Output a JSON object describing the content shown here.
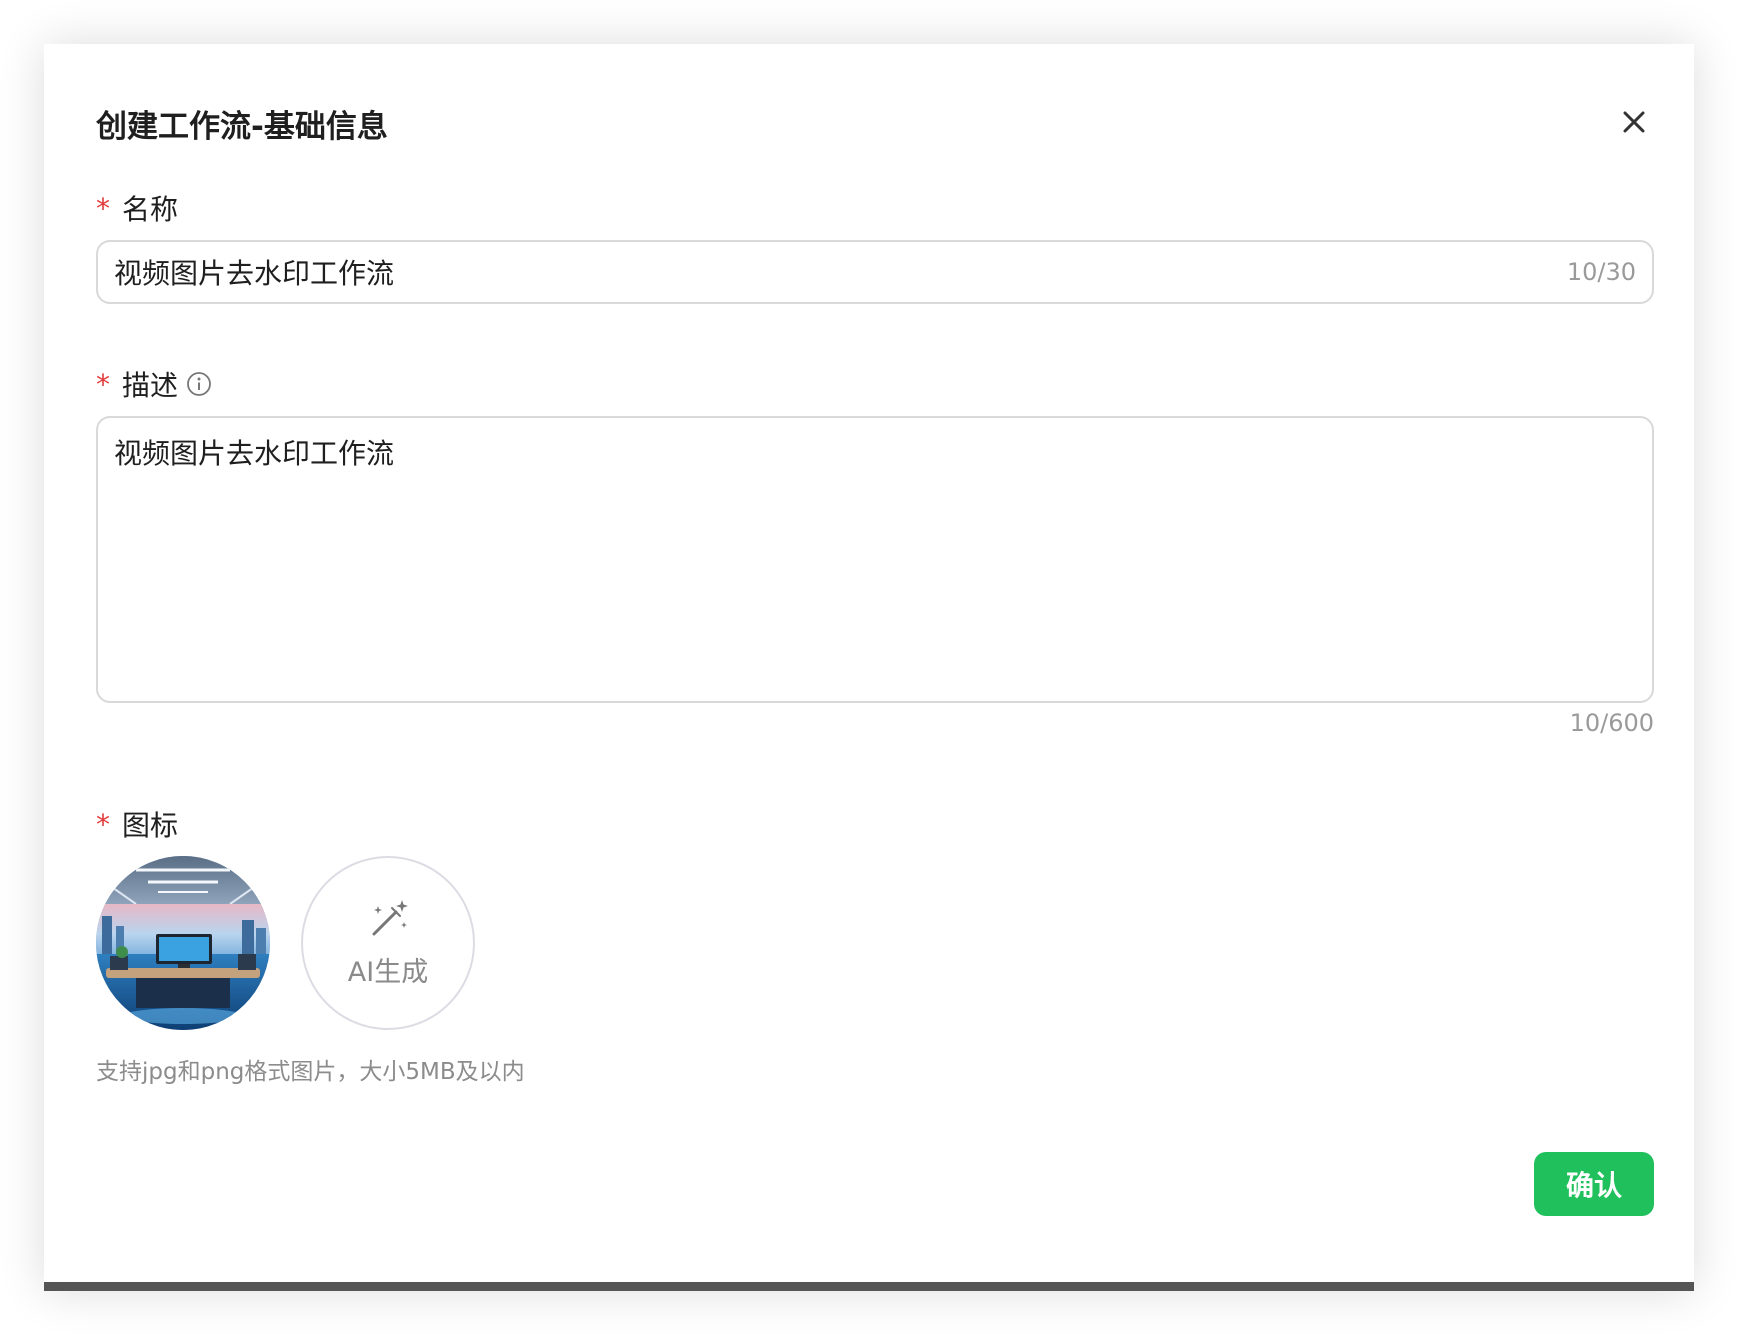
{
  "dialog": {
    "title": "创建工作流-基础信息",
    "close_icon": "close-icon"
  },
  "name_field": {
    "required_mark": "*",
    "label": "名称",
    "value": "视频图片去水印工作流",
    "counter": "10/30"
  },
  "description_field": {
    "required_mark": "*",
    "label": "描述",
    "info_icon": "info-circle-icon",
    "value": "视频图片去水印工作流",
    "counter": "10/600"
  },
  "icon_field": {
    "required_mark": "*",
    "label": "图标",
    "thumbnail_subject": "futuristic office image",
    "ai_button_icon": "magic-wand-icon",
    "ai_button_label": "AI生成",
    "hint": "支持jpg和png格式图片，大小5MB及以内"
  },
  "footer": {
    "confirm_label": "确认"
  },
  "colors": {
    "required": "#e23b3b",
    "primary": "#20c05c",
    "border": "#d9d9d9",
    "muted_text": "#9a9a9a"
  }
}
